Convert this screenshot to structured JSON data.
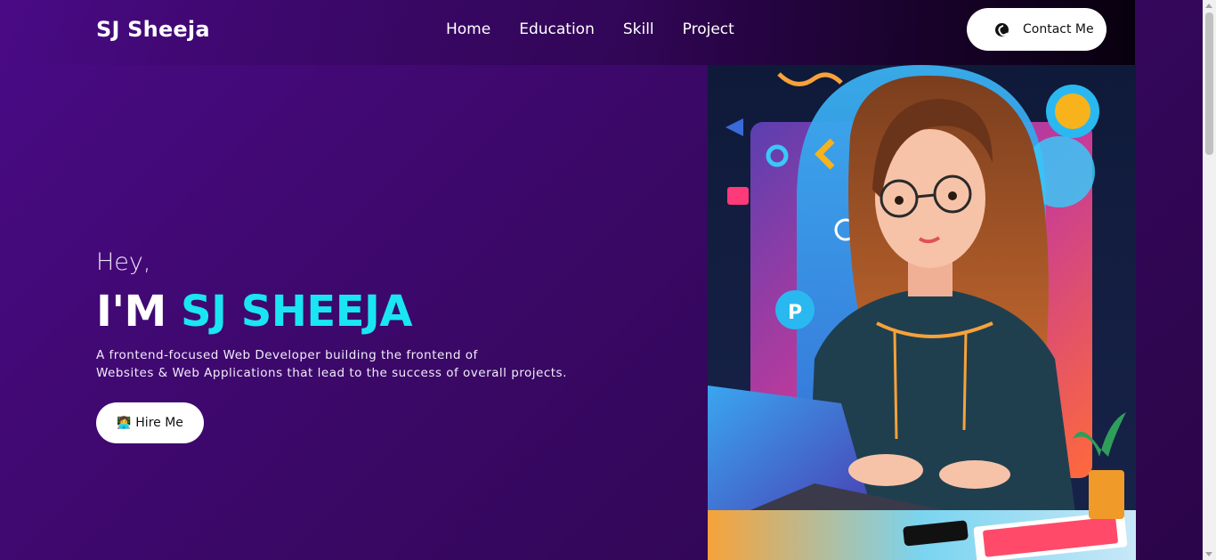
{
  "header": {
    "logo": "SJ Sheeja",
    "nav": [
      "Home",
      "Education",
      "Skill",
      "Project"
    ],
    "contact_label": "Contact Me"
  },
  "hero": {
    "greeting": "Hey,",
    "title_prefix": "I'M",
    "title_name": "SJ SHEEJA",
    "description_line1": "A frontend-focused Web Developer building the frontend of",
    "description_line2": "Websites & Web Applications that lead to the success of overall projects.",
    "hire_label": "Hire Me",
    "hire_icon": "👩‍💻"
  },
  "colors": {
    "background": "#3a0866",
    "accent": "#19e6f2",
    "button_bg": "#ffffff"
  },
  "icons": {
    "contact": "phone-icon",
    "hire": "woman-technologist-icon"
  }
}
